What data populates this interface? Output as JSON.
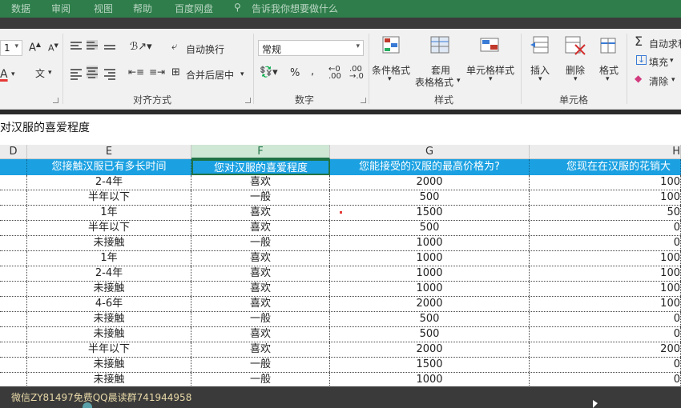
{
  "menu": {
    "tabs": [
      "数据",
      "审阅",
      "视图",
      "帮助",
      "百度网盘"
    ],
    "tell_me": "告诉我你想要做什么"
  },
  "ribbon": {
    "font_size_value": "1",
    "font_grow": "A",
    "font_shrink": "A",
    "font_color": "A",
    "phonetic": "文",
    "alignment": {
      "wrap_text": "自动换行",
      "merge_center": "合并后居中",
      "group_label": "对齐方式"
    },
    "number": {
      "format_value": "常规",
      "percent": "%",
      "comma": ",",
      "group_label": "数字"
    },
    "styles": {
      "conditional": "条件格式",
      "table_format_1": "套用",
      "table_format_2": "表格格式",
      "cell_styles": "单元格样式",
      "group_label": "样式"
    },
    "cells": {
      "insert": "插入",
      "delete": "删除",
      "format": "格式",
      "group_label": "单元格"
    },
    "editing": {
      "autosum": "自动求和",
      "fill": "填充",
      "clear": "清除"
    }
  },
  "formula_bar": {
    "content": "对汉服的喜爱程度"
  },
  "columns": [
    {
      "letter": "D",
      "selected": false
    },
    {
      "letter": "E",
      "selected": false
    },
    {
      "letter": "F",
      "selected": true
    },
    {
      "letter": "G",
      "selected": false
    },
    {
      "letter": "H",
      "selected": false
    }
  ],
  "header_row": [
    "",
    "您接触汉服已有多长时间",
    "您对汉服的喜爱程度",
    "您能接受的汉服的最高价格为?",
    "您现在在汉服的花销大"
  ],
  "rows": [
    [
      "2-4年",
      "喜欢",
      "2000",
      "100"
    ],
    [
      "半年以下",
      "一般",
      "500",
      "100"
    ],
    [
      "1年",
      "喜欢",
      "1500",
      "50"
    ],
    [
      "半年以下",
      "喜欢",
      "500",
      "0"
    ],
    [
      "未接触",
      "一般",
      "1000",
      "0"
    ],
    [
      "1年",
      "喜欢",
      "1000",
      "100"
    ],
    [
      "2-4年",
      "喜欢",
      "1000",
      "100"
    ],
    [
      "未接触",
      "喜欢",
      "1000",
      "100"
    ],
    [
      "4-6年",
      "喜欢",
      "2000",
      "100"
    ],
    [
      "未接触",
      "一般",
      "500",
      "0"
    ],
    [
      "未接触",
      "喜欢",
      "500",
      "0"
    ],
    [
      "半年以下",
      "喜欢",
      "2000",
      "200"
    ],
    [
      "未接触",
      "一般",
      "1500",
      "0"
    ],
    [
      "未接触",
      "一般",
      "1000",
      "0"
    ]
  ],
  "watermark": "微信ZY81497免费QQ晨读群741944958",
  "colors": {
    "header_fill": "#1ba1e2",
    "accent": "#217346"
  }
}
